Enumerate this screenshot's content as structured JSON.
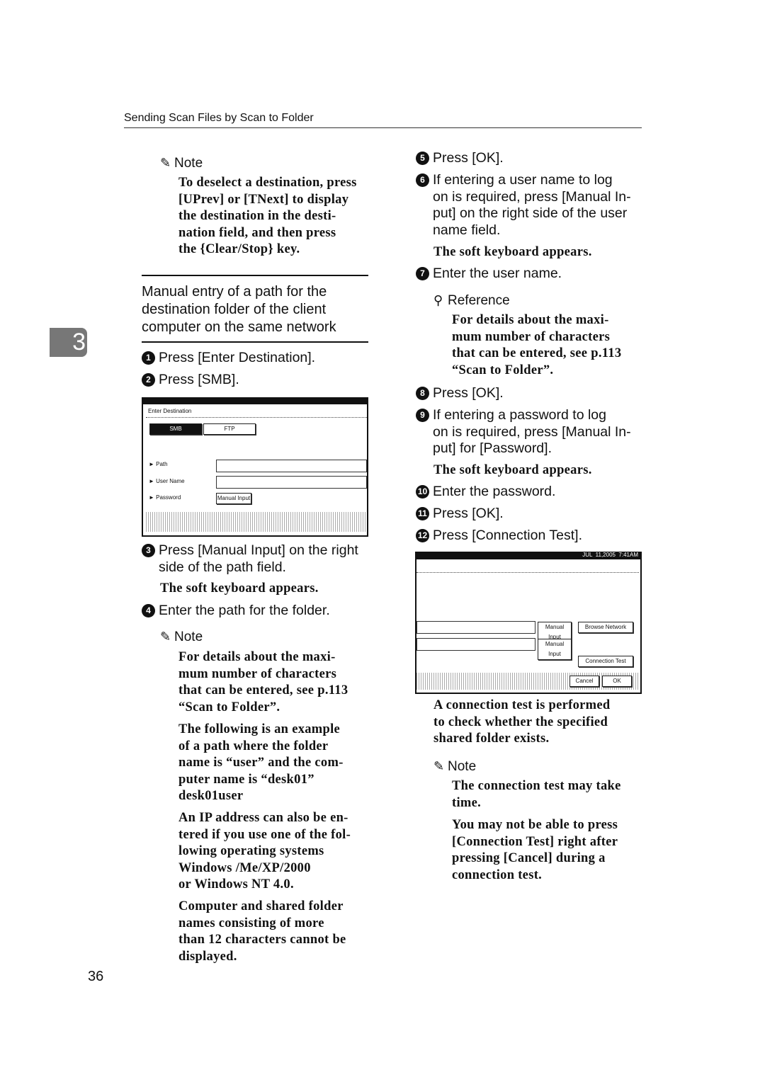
{
  "header": {
    "running_title": "Sending Scan Files by Scan to Folder"
  },
  "chapter_tab": "3",
  "page_number": "36",
  "left": {
    "note1": {
      "heading": "Note",
      "body": "To deselect a destination, press\n[UPrev] or [TNext] to display\nthe destination in the desti-\nnation field, and then press\nthe {Clear/Stop} key."
    },
    "section_title": "Manual entry of a path for the\ndestination folder of the client\ncomputer on the same network",
    "steps": [
      {
        "num": "1",
        "text": "Press [Enter Destination]."
      },
      {
        "num": "2",
        "text": "Press [SMB]."
      },
      {
        "num": "3",
        "text": "Press [Manual Input] on the right\nside of the path field."
      },
      {
        "num": "4",
        "text": "Enter the path for the folder."
      }
    ],
    "step3_result": "The soft keyboard appears.",
    "note2": {
      "heading": "Note",
      "paras": [
        "For details about the maxi-\nmum number of characters\nthat can be entered, see p.113\n“Scan to Folder”.",
        "The following is an example\nof a path where the folder\nname is “user” and the com-\nputer name is “desk01”\ndesk01user",
        "An IP address can also be en-\ntered if you use one of the fol-\nlowing operating systems\nWindows /Me/XP/2000\nor Windows NT 4.0.",
        "Computer and shared folder\nnames consisting of more\nthan 12 characters cannot be\ndisplayed."
      ]
    },
    "screen1": {
      "title": "Enter Destination",
      "tabs": [
        "SMB",
        "FTP"
      ],
      "active_tab": "SMB",
      "labels": [
        "Path",
        "User Name",
        "Password"
      ],
      "manual_input": "Manual Input"
    }
  },
  "right": {
    "steps": [
      {
        "num": "5",
        "text": "Press [OK]."
      },
      {
        "num": "6",
        "text": "If entering a user name to log\non is required, press [Manual In-\nput] on the right side of the user\nname field."
      },
      {
        "num": "7",
        "text": "Enter the user name."
      },
      {
        "num": "8",
        "text": "Press [OK]."
      },
      {
        "num": "9",
        "text": "If entering a password to log\non is required, press [Manual In-\nput] for [Password]."
      },
      {
        "num": "10",
        "text": "Enter the password."
      },
      {
        "num": "11",
        "text": "Press [OK]."
      },
      {
        "num": "12",
        "text": "Press [Connection Test]."
      }
    ],
    "step6_result": "The soft keyboard appears.",
    "reference": {
      "heading": "Reference",
      "body": "For details about the maxi-\nmum number of characters\nthat can be entered, see p.113\n“Scan to Folder”."
    },
    "step9_result": "The soft keyboard appears.",
    "step12_result": "A connection test is performed\nto check whether the specified\nshared folder exists.",
    "note": {
      "heading": "Note",
      "paras": [
        "The connection test may take\ntime.",
        "You may not be able to press\n[Connection Test] right after\npressing [Cancel] during a\nconnection test."
      ]
    },
    "screen2": {
      "datetime": "JUL  11,2005  7:41AM",
      "manual_input": "Manual Input",
      "browse": "Browse Network",
      "conn_test": "Connection Test",
      "cancel": "Cancel",
      "ok": "OK"
    }
  }
}
